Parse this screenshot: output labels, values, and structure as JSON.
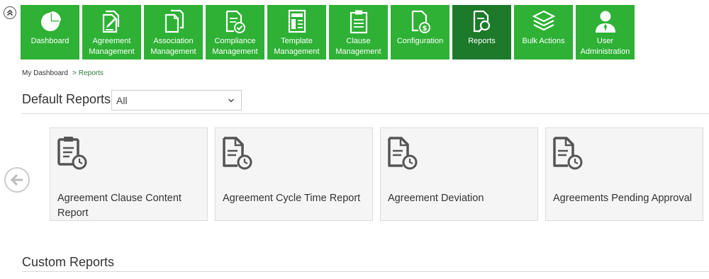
{
  "nav": {
    "items": [
      {
        "label": "Dashboard",
        "icon": "pie-chart-icon",
        "active": false
      },
      {
        "label": "Agreement Management",
        "icon": "documents-edit-icon",
        "active": false
      },
      {
        "label": "Association Management",
        "icon": "documents-stack-icon",
        "active": false
      },
      {
        "label": "Compliance Management",
        "icon": "document-check-icon",
        "active": false
      },
      {
        "label": "Template Management",
        "icon": "template-icon",
        "active": false
      },
      {
        "label": "Clause Management",
        "icon": "clipboard-icon",
        "active": false
      },
      {
        "label": "Configuration",
        "icon": "document-dollar-icon",
        "active": false
      },
      {
        "label": "Reports",
        "icon": "document-search-icon",
        "active": true
      },
      {
        "label": "Bulk Actions",
        "icon": "layers-icon",
        "active": false
      },
      {
        "label": "User Administration",
        "icon": "user-admin-icon",
        "active": false
      }
    ]
  },
  "breadcrumb": {
    "home": "My Dashboard",
    "separator": ">",
    "current": "Reports"
  },
  "default_reports": {
    "title": "Default Reports",
    "filter_value": "All",
    "cards": [
      {
        "title": "Agreement Clause Content Report",
        "icon": "clipboard-clock-icon"
      },
      {
        "title": "Agreement Cycle Time Report",
        "icon": "document-clock-icon"
      },
      {
        "title": "Agreement Deviation",
        "icon": "document-clock-icon"
      },
      {
        "title": "Agreements Pending Approval",
        "icon": "document-clock-icon"
      }
    ]
  },
  "custom_reports": {
    "title": "Custom Reports"
  },
  "colors": {
    "nav_bg": "#2eb135",
    "nav_active_bg": "#1c7a2a",
    "card_bg": "#f5f5f5"
  }
}
